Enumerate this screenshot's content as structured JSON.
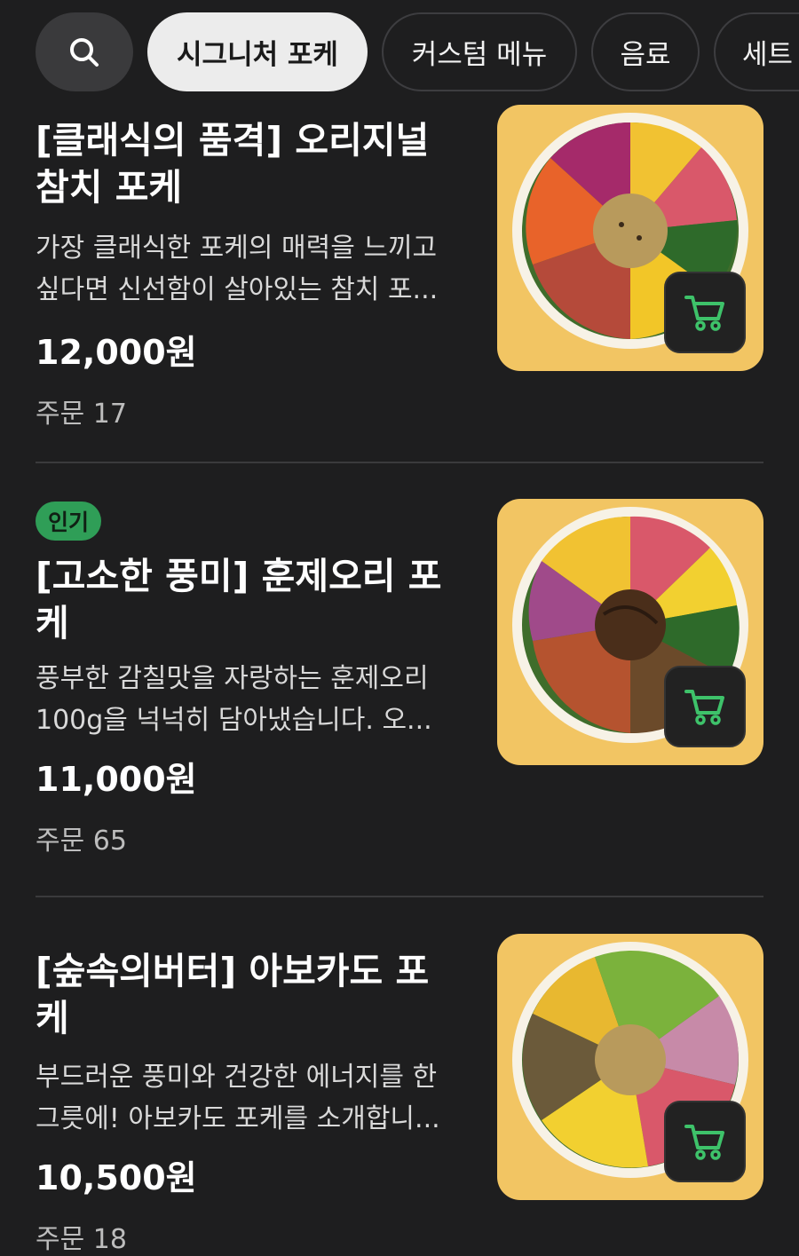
{
  "search": {
    "icon": "search-icon"
  },
  "categories": [
    {
      "label": "시그니처 포케",
      "active": true
    },
    {
      "label": "커스텀 메뉴",
      "active": false
    },
    {
      "label": "음료",
      "active": false
    },
    {
      "label": "세트",
      "active": false
    }
  ],
  "items": [
    {
      "badge": "",
      "title": "[클래식의 품격] 오리지널 참치 포케",
      "description": "가장 클래식한 포케의 매력을 느끼고 싶다면 신선함이 살아있는 참치 포...",
      "price": "12,000원",
      "orders": "주문 17",
      "image": "tuna-poke-bowl"
    },
    {
      "badge": "인기",
      "title": "[고소한 풍미] 훈제오리 포케",
      "description": "풍부한 감칠맛을 자랑하는 훈제오리 100g을 넉넉히 담아냈습니다. 오...",
      "price": "11,000원",
      "orders": "주문 65",
      "image": "smoked-duck-poke-bowl"
    },
    {
      "badge": "",
      "title": "[숲속의버터] 아보카도 포케",
      "description": "부드러운 풍미와 건강한 에너지를 한 그릇에! 아보카도 포케를 소개합니...",
      "price": "10,500원",
      "orders": "주문 18",
      "image": "avocado-poke-bowl"
    }
  ],
  "colors": {
    "background": "#1e1e1f",
    "accent": "#2f9e57",
    "image_bg": "#f2c563"
  }
}
